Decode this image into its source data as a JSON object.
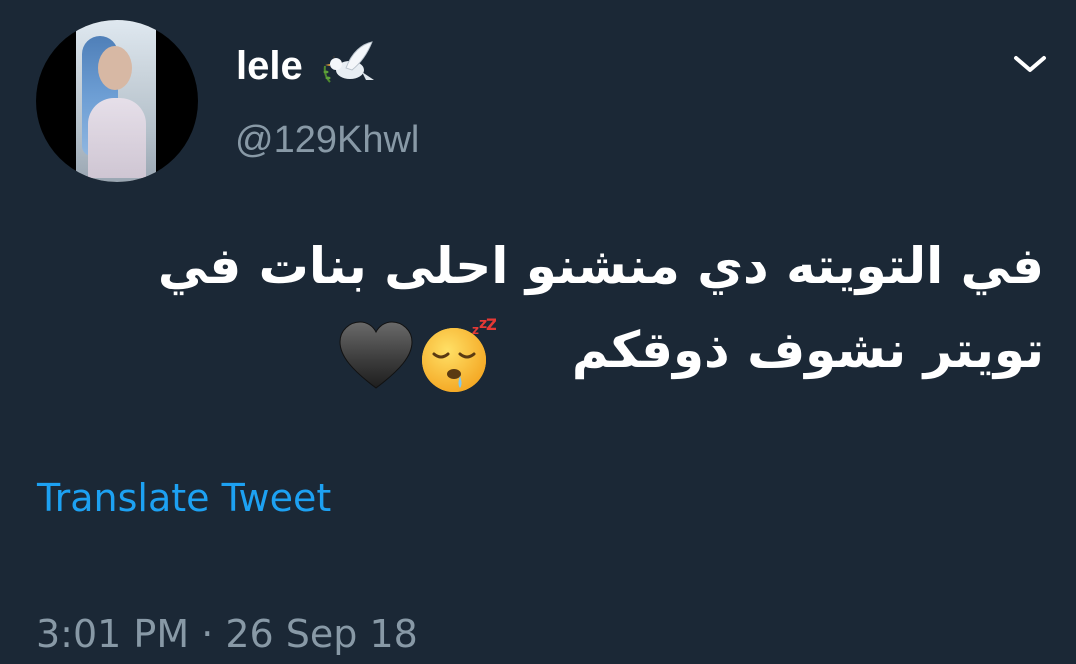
{
  "author": {
    "display_name": "lele",
    "handle": "@129Khwl",
    "name_emoji_icon": "dove-icon"
  },
  "tweet": {
    "text_line1": "في التويته دي منشنو احلى بنات في",
    "text_line2": "تويتر نشوف ذوقكم",
    "emojis": [
      "sleepy-face-icon",
      "black-heart-icon"
    ]
  },
  "actions": {
    "translate_label": "Translate Tweet",
    "menu_icon": "chevron-down-icon"
  },
  "meta": {
    "timestamp": "3:01 PM · 26 Sep 18"
  },
  "colors": {
    "background": "#1b2836",
    "text": "#ffffff",
    "secondary": "#8899a6",
    "link": "#1da1f2"
  }
}
